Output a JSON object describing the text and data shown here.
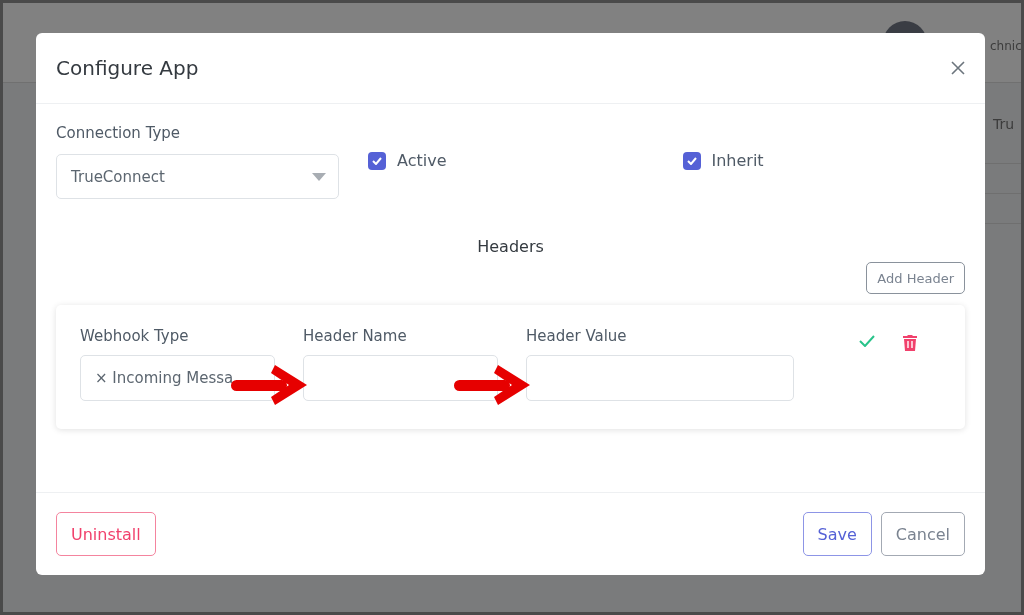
{
  "background": {
    "user_name": "chnic",
    "table_cell": "Tru"
  },
  "modal": {
    "title": "Configure App",
    "connection_type": {
      "label": "Connection Type",
      "value": "TrueConnect"
    },
    "checkboxes": [
      {
        "label": "Active",
        "checked": true
      },
      {
        "label": "Inherit",
        "checked": true
      }
    ],
    "headers": {
      "title": "Headers",
      "add_button": "Add Header",
      "rows": [
        {
          "webhook_type": {
            "label": "Webhook Type",
            "tag": "× Incoming Messa"
          },
          "header_name": {
            "label": "Header Name"
          },
          "header_value": {
            "label": "Header Value"
          }
        }
      ]
    },
    "footer_buttons": [
      {
        "label": "Uninstall",
        "kind": "danger"
      },
      {
        "label": "Save",
        "kind": "primary"
      },
      {
        "label": "Cancel",
        "kind": "secondary"
      }
    ]
  }
}
